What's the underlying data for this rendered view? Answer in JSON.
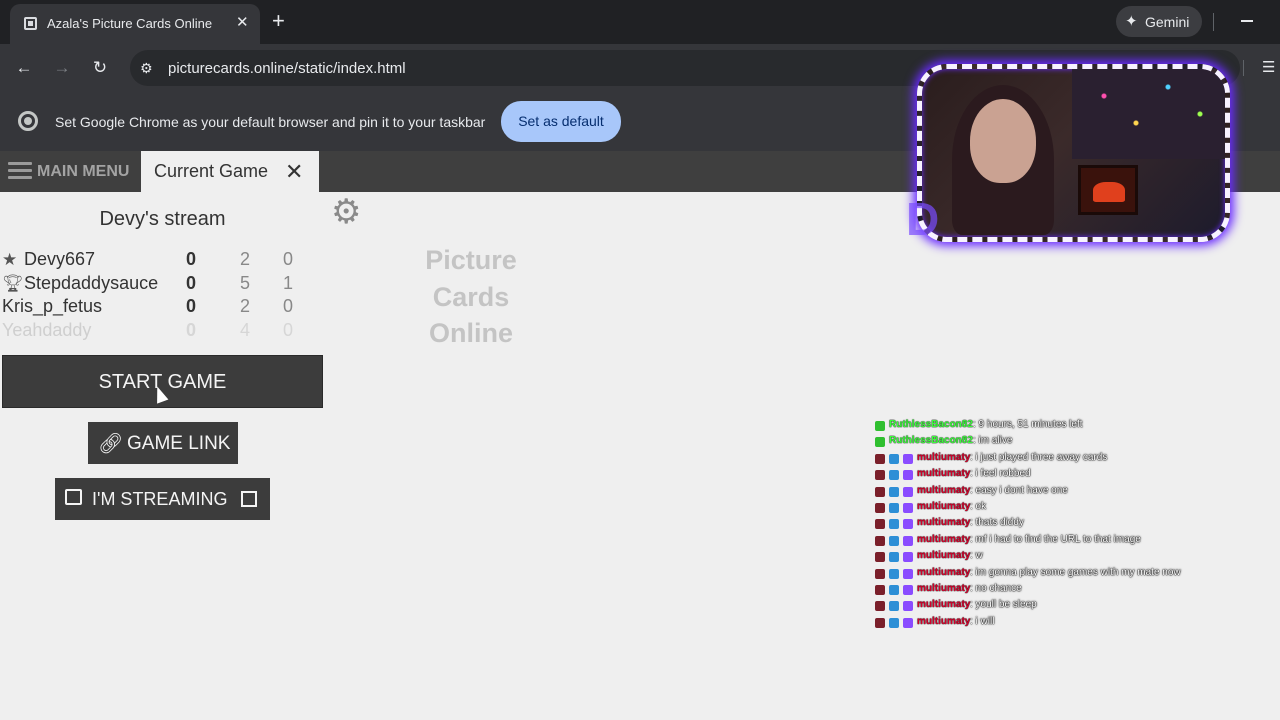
{
  "browser": {
    "tab_title": "Azala's Picture Cards Online",
    "gemini_label": "Gemini",
    "url": "picturecards.online/static/index.html",
    "infobar_text": "Set Google Chrome as your default browser and pin it to your taskbar",
    "set_default_label": "Set as default"
  },
  "app": {
    "menu_label": "MAIN MENU",
    "current_tab_label": "Current Game"
  },
  "game": {
    "stream_title": "Devy's stream",
    "players": [
      {
        "name": "Devy667",
        "icon": "star-icon",
        "s1": "0",
        "s2": "2",
        "s3": "0"
      },
      {
        "name": "Stepdaddysauce",
        "icon": "trophy-icon",
        "s1": "0",
        "s2": "5",
        "s3": "1"
      },
      {
        "name": "Kris_p_fetus",
        "icon": "",
        "s1": "0",
        "s2": "2",
        "s3": "0"
      },
      {
        "name": "Yeahdaddy",
        "icon": "",
        "s1": "0",
        "s2": "4",
        "s3": "0"
      }
    ],
    "start_label": "START GAME",
    "link_label": "GAME LINK",
    "stream_label": "I'M STREAMING",
    "logo_lines": [
      "Picture",
      "Cards",
      "Online"
    ]
  },
  "chat": [
    {
      "user": "RuthlessBacon82",
      "msg": ": 9 hours, 51 minutes left",
      "color": "#3aff3a"
    },
    {
      "user": "RuthlessBacon82",
      "msg": ": im alive",
      "color": "#3aff3a"
    },
    {
      "user": "multiumaty",
      "msg": ": i just played three away cards",
      "color": "#d4002a"
    },
    {
      "user": "multiumaty",
      "msg": ": i feel robbed",
      "color": "#d4002a"
    },
    {
      "user": "multiumaty",
      "msg": ": easy i dont have one",
      "color": "#d4002a"
    },
    {
      "user": "multiumaty",
      "msg": ": ok",
      "color": "#d4002a"
    },
    {
      "user": "multiumaty",
      "msg": ": thats diddy",
      "color": "#d4002a"
    },
    {
      "user": "multiumaty",
      "msg": ": mf i had to find the URL to that image",
      "color": "#d4002a"
    },
    {
      "user": "multiumaty",
      "msg": ": w",
      "color": "#d4002a"
    },
    {
      "user": "multiumaty",
      "msg": ": im gonna play some games with my mate now",
      "color": "#d4002a"
    },
    {
      "user": "multiumaty",
      "msg": ": no chance",
      "color": "#d4002a"
    },
    {
      "user": "multiumaty",
      "msg": ": youll be sleep",
      "color": "#d4002a"
    },
    {
      "user": "multiumaty",
      "msg": ": i will",
      "color": "#d4002a"
    }
  ]
}
